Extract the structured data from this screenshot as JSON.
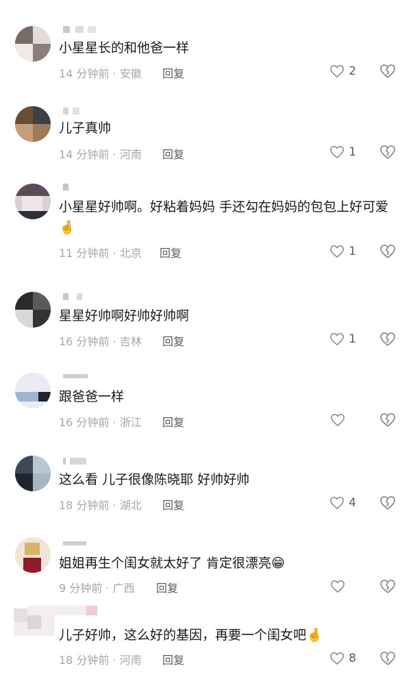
{
  "comments": [
    {
      "text": "小星星长的和他爸一样",
      "meta": "14 分钟前 · 安徽",
      "reply": "回复",
      "likes": "2",
      "emoji": ""
    },
    {
      "text": "儿子真帅",
      "meta": "14 分钟前 · 河南",
      "reply": "回复",
      "likes": "1",
      "emoji": ""
    },
    {
      "text": "小星星好帅啊。好粘着妈妈 手还勾在妈妈的包包上好可爱",
      "meta": "11 分钟前 · 北京",
      "reply": "回复",
      "likes": "1",
      "emoji": "🤞"
    },
    {
      "text": "星星好帅啊好帅好帅啊",
      "meta": "16 分钟前 · 吉林",
      "reply": "回复",
      "likes": "1",
      "emoji": ""
    },
    {
      "text": "跟爸爸一样",
      "meta": "16 分钟前 · 浙江",
      "reply": "回复",
      "likes": "",
      "emoji": ""
    },
    {
      "text": "这么看 儿子很像陈晓耶 好帅好帅",
      "meta": "18 分钟前 · 湖北",
      "reply": "回复",
      "likes": "4",
      "emoji": ""
    },
    {
      "text": "姐姐再生个闺女就太好了 肯定很漂亮",
      "meta": "9 分钟前 · 广西",
      "reply": "回复",
      "likes": "",
      "emoji": "😁"
    },
    {
      "text": "儿子好帅，这么好的基因，再要一个闺女吧",
      "meta": "18 分钟前 · 河南",
      "reply": "回复",
      "likes": "8",
      "emoji": "🤞"
    }
  ],
  "icons": {
    "like": "heart-outline-icon",
    "dislike": "broken-heart-icon"
  },
  "colors": {
    "text": "#161823",
    "meta": "#a5a7ad",
    "action": "#5a5c63"
  }
}
